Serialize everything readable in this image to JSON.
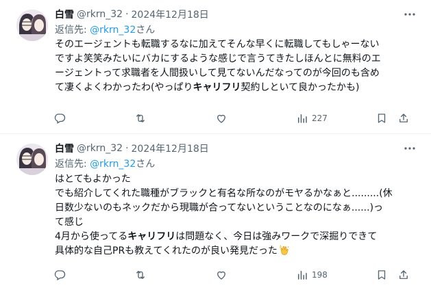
{
  "tweets": [
    {
      "display_name": "白雪",
      "handle": "@rkrn_32",
      "separator": "·",
      "date": "2024年12月18日",
      "reply_label": "返信先: ",
      "reply_mention": "@rkrn_32",
      "reply_suffix": "さん",
      "body": {
        "l1": "そのエージェントも転職するなに加えてそんな早くに転職してもしゃーない",
        "l2": "ですよ笑笑みたいにバカにするような感じで言うてきたしほんとに無料のエ",
        "l3": "ージェントって求職者を人間扱いして見てないんだなってのが今回のも含め",
        "l4_a": "て凄くよくわかったわ(やっぱり",
        "l4_bold": "キャリフリ",
        "l4_b": "契約しといて良かったかも)"
      },
      "views_count": "227",
      "icons": [
        "reply-icon",
        "retweet-icon",
        "like-icon",
        "views-icon",
        "bookmark-icon",
        "share-icon",
        "more-icon"
      ]
    },
    {
      "display_name": "白雪",
      "handle": "@rkrn_32",
      "separator": "·",
      "date": "2024年12月18日",
      "reply_label": "返信先: ",
      "reply_mention": "@rkrn_32",
      "reply_suffix": "さん",
      "body": {
        "l1": "はとてもよかった",
        "l2": "でも紹介してくれた職種がブラックと有名な所なのがモヤるかなぁと.........(休",
        "l3": "日数少ないのもネックだから現職が合ってないということなのになぁ......)っ",
        "l4": "て感じ",
        "l5_a": "4月から使ってる",
        "l5_bold": "キャリフリ",
        "l5_b": "は問題なく、今日は強みワークで深掘りできて",
        "l6": "具体的な自己PRも教えてくれたのが良い発見だった"
      },
      "emoji": "clapping-hands",
      "views_count": "198",
      "icons": [
        "reply-icon",
        "retweet-icon",
        "like-icon",
        "views-icon",
        "bookmark-icon",
        "share-icon",
        "more-icon"
      ]
    }
  ],
  "colors": {
    "text": "#0f1419",
    "secondary": "#536471",
    "link": "#1d9bf0",
    "divider": "#eff3f4"
  }
}
